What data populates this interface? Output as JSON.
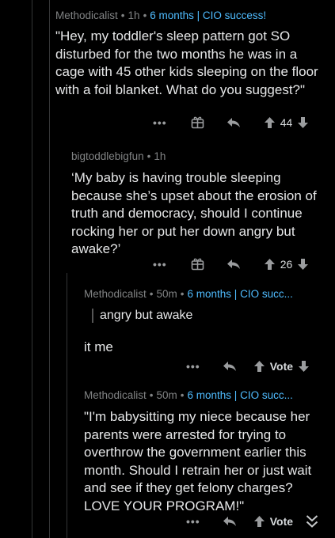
{
  "comments": [
    {
      "author": "Methodicalist",
      "age": "1h",
      "flair": "6 months | CIO success!",
      "body": "\"Hey, my toddler's sleep pattern got SO disturbed for the two months he was in a cage with 45 other kids sleeping on the floor with a foil blanket. What do you suggest?\"",
      "score": "44"
    },
    {
      "author": "bigtoddlebigfun",
      "age": "1h",
      "body": "‘My baby is having trouble sleeping because she’s upset about the erosion of truth and democracy, should I continue rocking her or put her down angry but awake?’",
      "score": "26"
    },
    {
      "author": "Methodicalist",
      "age": "50m",
      "flair": "6 months | CIO succ...",
      "quote": "angry but awake",
      "body": "it me",
      "score": "Vote"
    },
    {
      "author": "Methodicalist",
      "age": "50m",
      "flair": "6 months | CIO succ...",
      "body": "\"I'm babysitting my niece because her parents were arrested for trying to overthrow the government earlier this month.  Should I retrain her or just wait and see if they get felony charges?  LOVE YOUR PROGRAM!\"",
      "score": "Vote"
    }
  ],
  "separator": "•",
  "more_label": "•••"
}
